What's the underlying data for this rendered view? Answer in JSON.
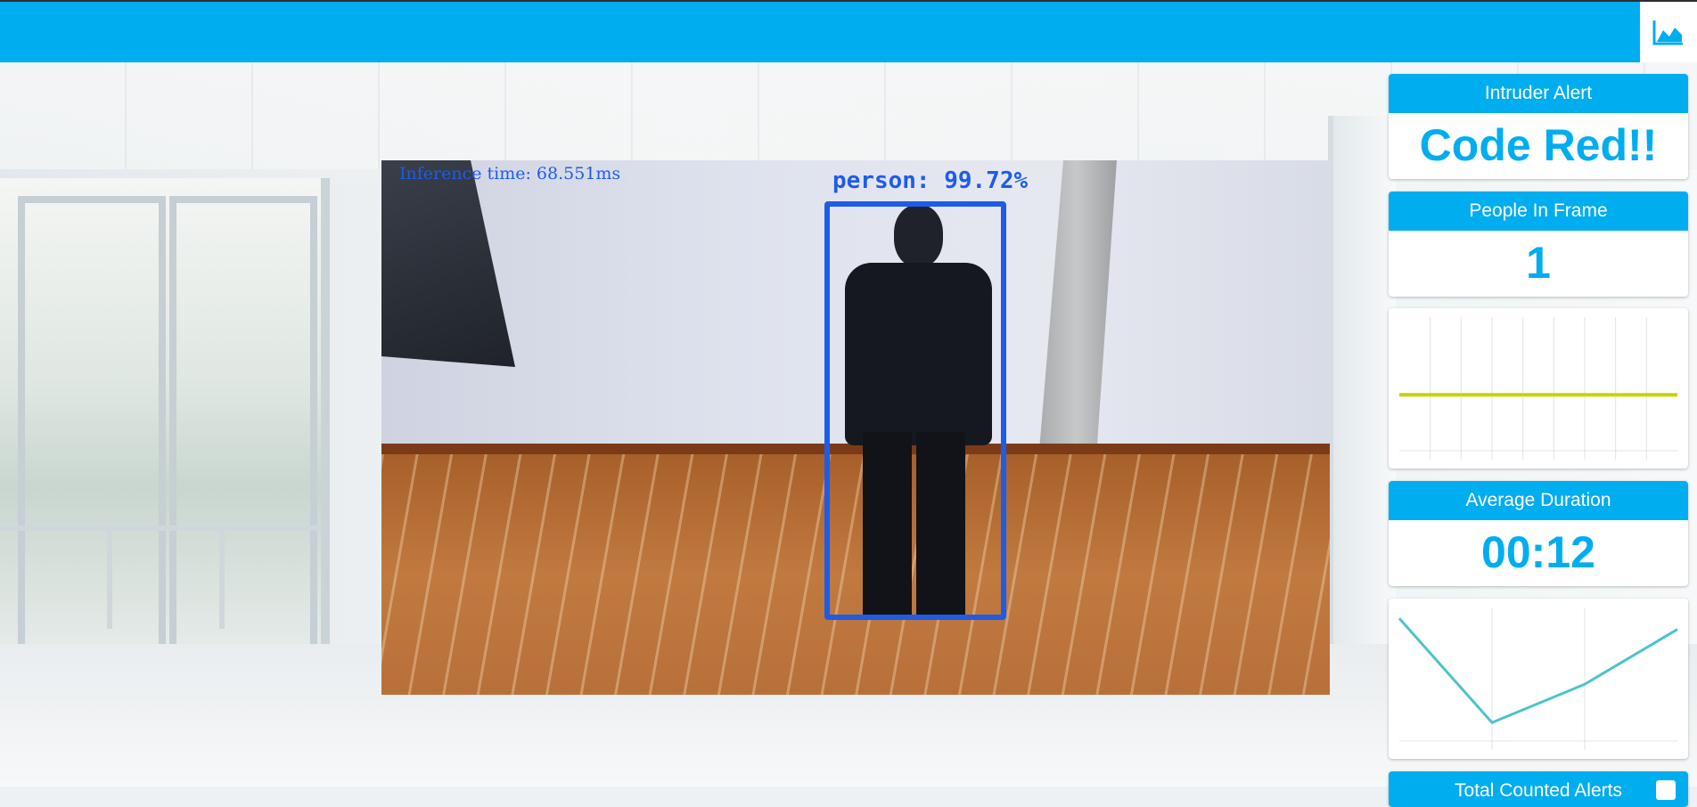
{
  "app": {
    "topbar_icon": "area-chart-icon",
    "accent": "#00adef"
  },
  "video": {
    "inference_text": "Inference time: 68.551ms",
    "detection_label": "person: 99.72%",
    "bbox_color": "#1e5ce8"
  },
  "cards": {
    "intruder_alert": {
      "title": "Intruder Alert",
      "value": "Code Red!!"
    },
    "people_in_frame": {
      "title": "People In Frame",
      "value": "1"
    },
    "average_duration": {
      "title": "Average Duration",
      "value": "00:12"
    },
    "total_counted": {
      "title": "Total Counted Alerts",
      "icon": "chart-icon"
    }
  },
  "chart_data": [
    {
      "type": "line",
      "series": [
        {
          "values": [
            1,
            1,
            1,
            1,
            1,
            1,
            1,
            1,
            1,
            1
          ]
        }
      ],
      "line_color": "#c8d400",
      "grid": true
    },
    {
      "type": "line",
      "series": [
        {
          "values": [
            12,
            2.5,
            6,
            11
          ]
        }
      ],
      "line_color": "#4cc3c9",
      "grid": true
    }
  ]
}
